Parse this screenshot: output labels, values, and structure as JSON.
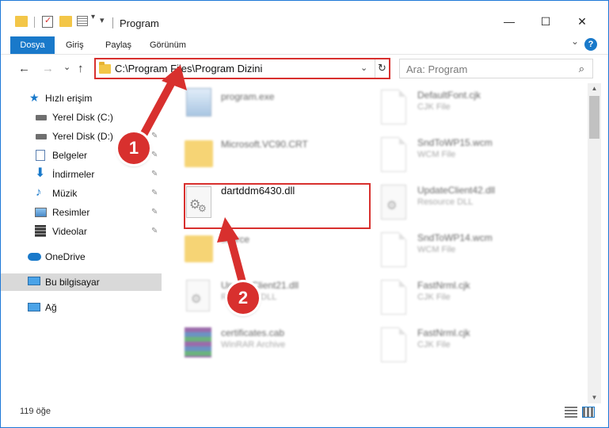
{
  "window": {
    "title": "Program",
    "controls": {
      "minimize": "—",
      "maximize": "☐",
      "close": "✕"
    }
  },
  "ribbon": {
    "tabs": [
      {
        "label": "Dosya",
        "active": true
      },
      {
        "label": "Giriş",
        "active": false
      },
      {
        "label": "Paylaş",
        "active": false
      },
      {
        "label": "Görünüm",
        "active": false
      }
    ],
    "expand_glyph": "⌄",
    "help_glyph": "?"
  },
  "nav": {
    "back": "←",
    "forward": "→",
    "recent": "⌄",
    "up": "↑",
    "address": "C:\\Program Files\\Program Dizini",
    "address_dropdown": "⌄",
    "refresh": "↻",
    "search_placeholder": "Ara: Program",
    "search_icon": "⌕"
  },
  "sidebar": {
    "items": [
      {
        "label": "Hızlı erişim",
        "icon": "star-icon",
        "pinned": false
      },
      {
        "label": "Yerel Disk (C:)",
        "icon": "drive-icon",
        "pinned": true
      },
      {
        "label": "Yerel Disk (D:)",
        "icon": "drive-icon",
        "pinned": true
      },
      {
        "label": "Belgeler",
        "icon": "documents-icon",
        "pinned": true
      },
      {
        "label": "İndirmeler",
        "icon": "downloads-icon",
        "pinned": true
      },
      {
        "label": "Müzik",
        "icon": "music-icon",
        "pinned": true
      },
      {
        "label": "Resimler",
        "icon": "pictures-icon",
        "pinned": true
      },
      {
        "label": "Videolar",
        "icon": "videos-icon",
        "pinned": true
      },
      {
        "label": "OneDrive",
        "icon": "cloud-icon",
        "pinned": false
      },
      {
        "label": "Bu bilgisayar",
        "icon": "computer-icon",
        "pinned": false,
        "selected": true
      },
      {
        "label": "Ağ",
        "icon": "network-icon",
        "pinned": false
      }
    ],
    "pin_glyph": "📌"
  },
  "files": {
    "left": [
      {
        "name": "program.exe",
        "type": "",
        "icon": "exe-icon"
      },
      {
        "name": "Microsoft.VC90.CRT",
        "type": "",
        "icon": "folder-icon"
      },
      {
        "name": "dartddm6430.dll",
        "type": "",
        "icon": "dll-gear-icon",
        "highlighted": true
      },
      {
        "name": "source",
        "type": "",
        "icon": "folder-icon"
      },
      {
        "name": "UpdateClient21.dll",
        "type": "Resource DLL",
        "icon": "dll-gear-icon"
      },
      {
        "name": "certificates.cab",
        "type": "WinRAR Archive",
        "icon": "winrar-icon"
      }
    ],
    "right": [
      {
        "name": "DefaultFont.cjk",
        "type": "CJK File",
        "icon": "document-icon"
      },
      {
        "name": "SndToWP15.wcm",
        "type": "WCM File",
        "icon": "document-icon"
      },
      {
        "name": "UpdateClient42.dll",
        "type": "Resource DLL",
        "icon": "dll-gear-icon"
      },
      {
        "name": "SndToWP14.wcm",
        "type": "WCM File",
        "icon": "document-icon"
      },
      {
        "name": "FastNrml.cjk",
        "type": "CJK File",
        "icon": "document-icon"
      },
      {
        "name": "FastNrml.cjk",
        "type": "CJK File",
        "icon": "document-icon"
      }
    ]
  },
  "status": {
    "item_count": "119 öğe"
  },
  "callouts": {
    "first": "1",
    "second": "2"
  },
  "colors": {
    "accent": "#1979ca",
    "highlight": "#d8302e",
    "folder": "#f3c648"
  }
}
